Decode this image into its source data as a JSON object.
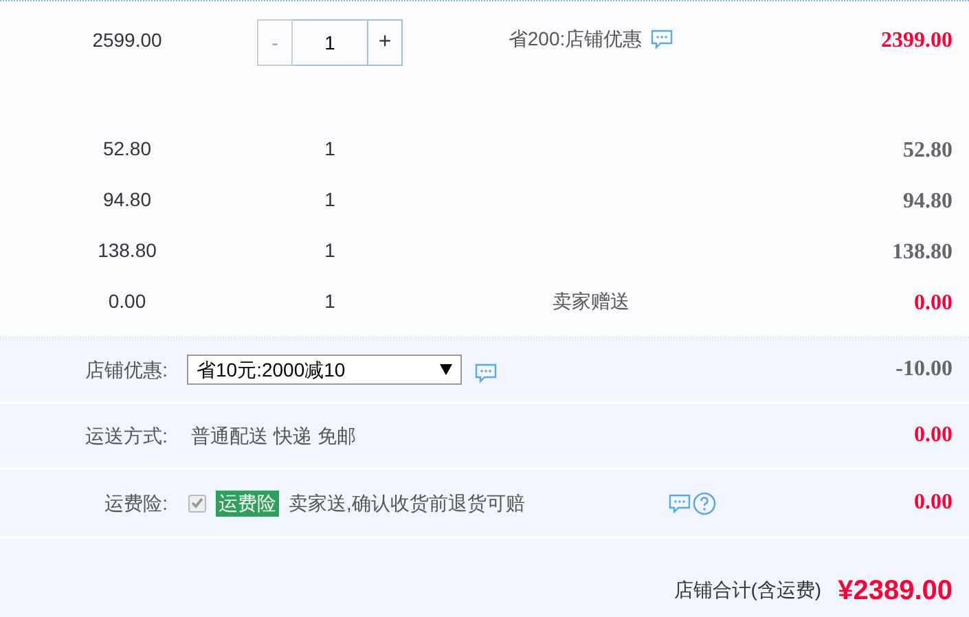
{
  "items": [
    {
      "kind": "stepper",
      "price": "2599.00",
      "quantity": "1",
      "minus": "-",
      "plus": "+",
      "minus_disabled": true,
      "note": "省200:店铺优惠",
      "total": "2399.00",
      "highlight": true
    },
    {
      "kind": "plain",
      "price": "52.80",
      "quantity": "1",
      "total": "52.80",
      "highlight": false
    },
    {
      "kind": "plain",
      "price": "94.80",
      "quantity": "1",
      "total": "94.80",
      "highlight": false
    },
    {
      "kind": "plain",
      "price": "138.80",
      "quantity": "1",
      "total": "138.80",
      "highlight": false
    },
    {
      "kind": "plain",
      "price": "0.00",
      "quantity": "1",
      "note": "卖家赠送",
      "total": "0.00",
      "highlight": true
    }
  ],
  "shop_discount": {
    "label": "店铺优惠:",
    "value": "省10元:2000减10",
    "amount": "-10.00",
    "highlight": false
  },
  "shipping": {
    "label": "运送方式:",
    "value": "普通配送 快递 免邮",
    "amount": "0.00",
    "highlight": true
  },
  "insurance": {
    "label": "运费险:",
    "checked": true,
    "tag": "运费险",
    "text": "卖家送,确认收货前退货可赔",
    "amount": "0.00",
    "highlight": true
  },
  "total": {
    "label": "店铺合计(含运费)",
    "amount": "¥2389.00"
  }
}
